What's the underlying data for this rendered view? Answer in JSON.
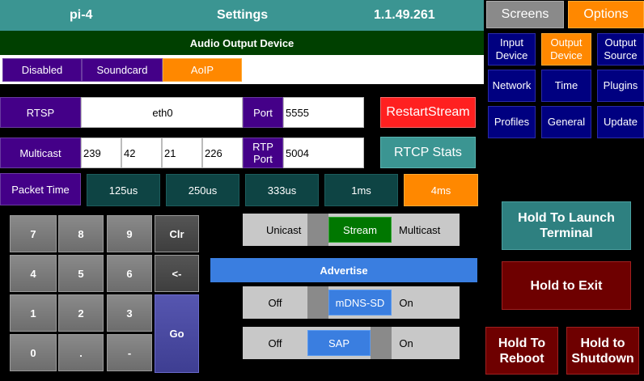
{
  "header": {
    "host": "pi-4",
    "title": "Settings",
    "version": "1.1.49.261"
  },
  "audio_output": {
    "title": "Audio Output Device",
    "options": [
      "Disabled",
      "Soundcard",
      "AoIP"
    ],
    "selected": "AoIP"
  },
  "rtsp": {
    "label": "RTSP",
    "interface": "eth0",
    "port_label": "Port",
    "port": "5555"
  },
  "multicast": {
    "label": "Multicast",
    "octets": [
      "239",
      "42",
      "21",
      "226"
    ],
    "rtp_port_label": "RTP Port",
    "rtp_port": "5004"
  },
  "packet_time": {
    "label": "Packet Time",
    "options": [
      "125us",
      "250us",
      "333us",
      "1ms",
      "4ms"
    ],
    "selected": "4ms"
  },
  "buttons": {
    "restart_stream": "RestartStream",
    "rtcp_stats": "RTCP Stats"
  },
  "keypad": {
    "rows": [
      [
        "7",
        "8",
        "9",
        "Clr"
      ],
      [
        "4",
        "5",
        "6",
        "<-"
      ],
      [
        "1",
        "2",
        "3"
      ],
      [
        "0",
        ".",
        "-"
      ]
    ],
    "go": "Go"
  },
  "stream_toggle": {
    "left": "Unicast",
    "knob": "Stream",
    "right": "Multicast"
  },
  "advertise": {
    "title": "Advertise"
  },
  "mdns_toggle": {
    "left": "Off",
    "knob": "mDNS-SD",
    "right": "On"
  },
  "sap_toggle": {
    "left": "Off",
    "knob": "SAP",
    "right": "On"
  },
  "tabs": {
    "screens": "Screens",
    "options": "Options"
  },
  "nav": {
    "input_device": "Input Device",
    "output_device": "Output Device",
    "output_source": "Output Source",
    "network": "Network",
    "time": "Time",
    "plugins": "Plugins",
    "profiles": "Profiles",
    "general": "General",
    "update": "Update"
  },
  "actions": {
    "launch_terminal": "Hold To Launch Terminal",
    "exit": "Hold to Exit",
    "reboot": "Hold To Reboot",
    "shutdown": "Hold to Shutdown"
  },
  "colors": {
    "accent_orange": "#ff8800",
    "header_teal": "#3b9592",
    "nav_blue": "#000080",
    "purple": "#440088",
    "green": "#007700",
    "red": "#ff2020",
    "dark_red": "#6e0000"
  }
}
